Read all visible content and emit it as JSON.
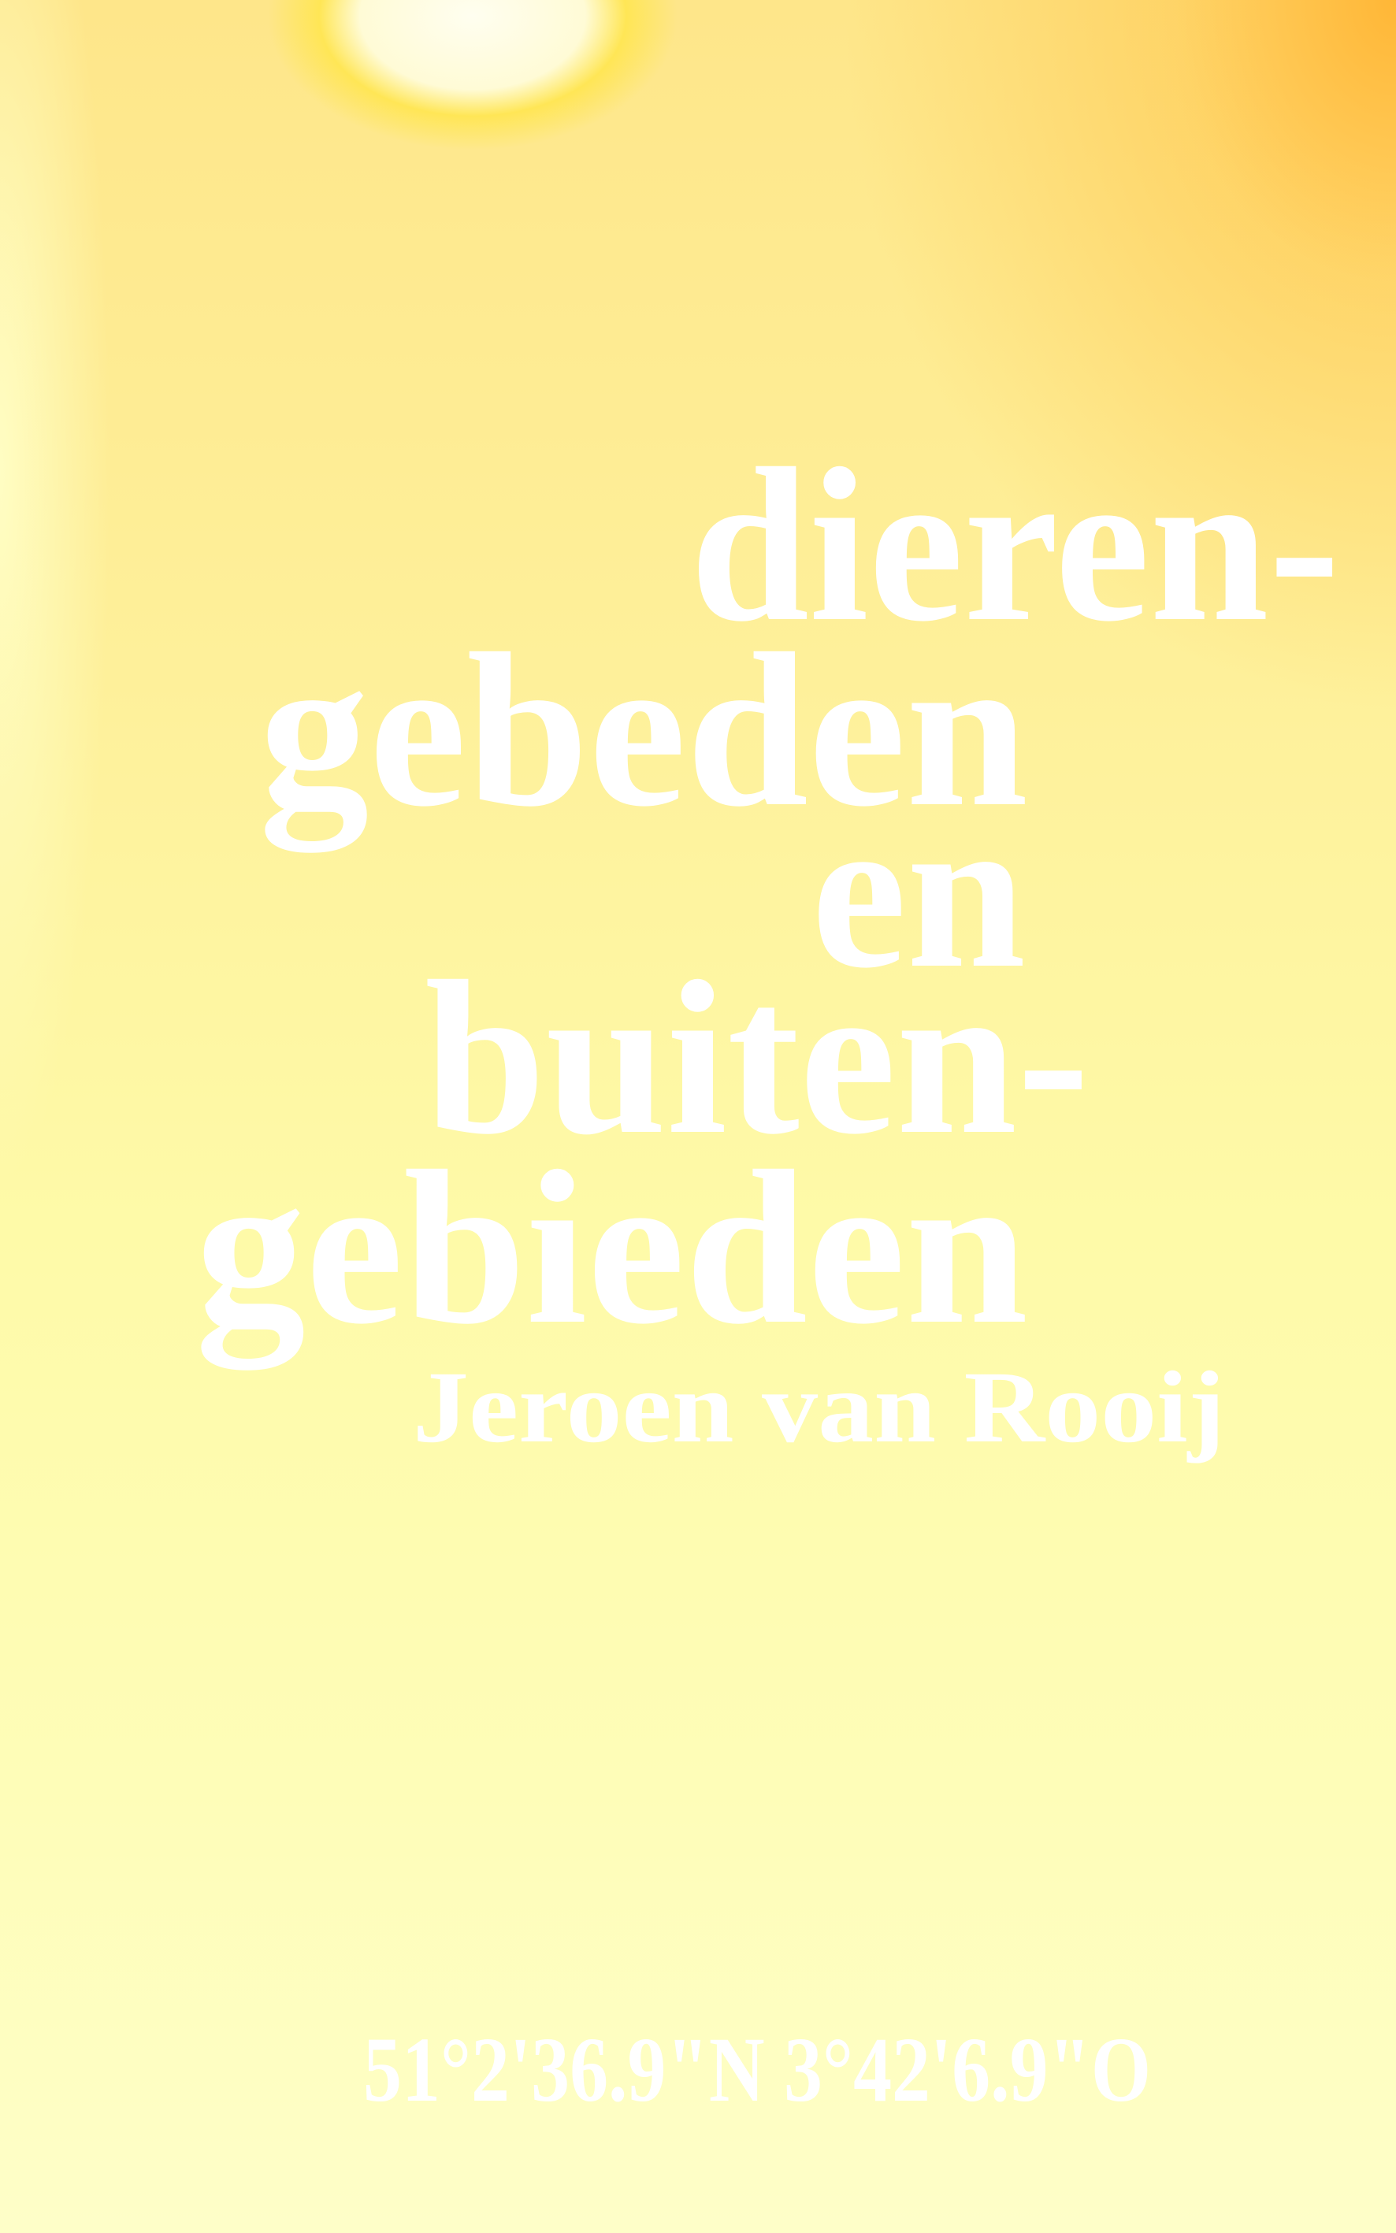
{
  "cover": {
    "title_lines": [
      "dieren-",
      "gebeden",
      "en",
      "buiten-",
      "gebieden"
    ],
    "author": "Jeroen van Rooij",
    "coordinates": "51°2'36.9\"N 3°42'6.9\"O"
  },
  "colors": {
    "background_top_right": "#ffc24a",
    "background_main": "#fef09a",
    "background_bottom": "#fefec8",
    "text": "#ffffff"
  }
}
